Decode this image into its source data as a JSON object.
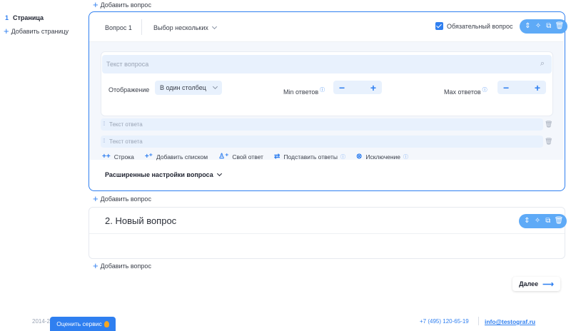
{
  "sidebar": {
    "page_number": "1",
    "page_label": "Страница",
    "add_page_label": "Добавить страницу"
  },
  "add_question_label": "Добавить вопрос",
  "question1": {
    "label": "Вопрос 1",
    "type": "Выбор нескольких",
    "required_label": "Обязательный вопрос",
    "required_checked": true,
    "question_placeholder": "Текст вопроса",
    "display_label": "Отображение",
    "display_value": "В один столбец",
    "min_label": "Min ответов",
    "max_label": "Max ответов",
    "answers": [
      {
        "placeholder": "Текст ответа"
      },
      {
        "placeholder": "Текст ответа"
      }
    ],
    "actions": [
      {
        "icon": "double-plus-icon",
        "label": "Строка"
      },
      {
        "icon": "list-plus-icon",
        "label": "Добавить списком"
      },
      {
        "icon": "user-plus-icon",
        "label": "Свой ответ"
      },
      {
        "icon": "substitute-icon",
        "label": "Подставить ответы"
      },
      {
        "icon": "exclude-icon",
        "label": "Исключение"
      }
    ],
    "advanced_label": "Расширенные настройки вопроса"
  },
  "question2": {
    "title": "2. Новый вопрос"
  },
  "next_label": "Далее",
  "footer": {
    "copyright": "2014-2",
    "rate_label": "Оценить сервис",
    "phone": "+7 (495) 120-65-19",
    "email": "info@testograf.ru"
  },
  "colors": {
    "accent": "#2f7ff0",
    "toolbar": "#5eaaf7",
    "field_bg": "#e8f1fd"
  }
}
